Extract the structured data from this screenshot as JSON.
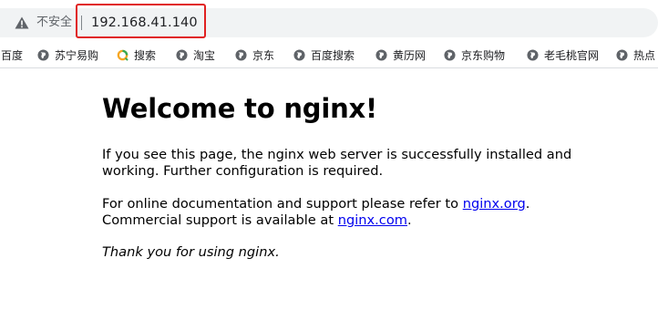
{
  "browser": {
    "security_label": "不安全",
    "url": "192.168.41.140"
  },
  "bookmarks": [
    {
      "label": "百度",
      "icon": "globe-icon"
    },
    {
      "label": "苏宁易购",
      "icon": "globe-icon"
    },
    {
      "label": "搜索",
      "icon": "search-ring-icon"
    },
    {
      "label": "淘宝",
      "icon": "globe-icon"
    },
    {
      "label": "京东",
      "icon": "globe-icon"
    },
    {
      "label": "百度搜索",
      "icon": "globe-icon"
    },
    {
      "label": "黄历网",
      "icon": "globe-icon"
    },
    {
      "label": "京东购物",
      "icon": "globe-icon"
    },
    {
      "label": "老毛桃官网",
      "icon": "globe-icon"
    },
    {
      "label": "热点",
      "icon": "globe-icon"
    }
  ],
  "page": {
    "heading": "Welcome to nginx!",
    "intro_line1": "If you see this page, the nginx web server is successfully installed and",
    "intro_line2": "working. Further configuration is required.",
    "docs_prefix": "For online documentation and support please refer to ",
    "docs_link": "nginx.org",
    "docs_suffix": ".",
    "support_prefix": "Commercial support is available at ",
    "support_link": "nginx.com",
    "support_suffix": ".",
    "thanks": "Thank you for using nginx."
  },
  "colors": {
    "link": "#0000ee",
    "highlight_box": "#e02020",
    "omnibox_bg": "#f1f3f4"
  }
}
